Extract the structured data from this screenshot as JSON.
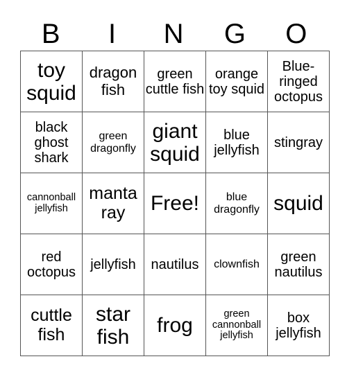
{
  "header": {
    "letters": [
      "B",
      "I",
      "N",
      "G",
      "O"
    ]
  },
  "grid": {
    "rows": [
      [
        "toy squid",
        "dragon fish",
        "green cuttle fish",
        "orange toy squid",
        "Blue-ringed octopus"
      ],
      [
        "black ghost shark",
        "green dragonfly",
        "giant squid",
        "blue jellyfish",
        "stingray"
      ],
      [
        "cannonball jellyfish",
        "manta ray",
        "Free!",
        "blue dragonfly",
        "squid"
      ],
      [
        "red octopus",
        "jellyfish",
        "nautilus",
        "clownfish",
        "green nautilus"
      ],
      [
        "cuttle fish",
        "star fish",
        "frog",
        "green cannonball jellyfish",
        "box jellyfish"
      ]
    ]
  }
}
